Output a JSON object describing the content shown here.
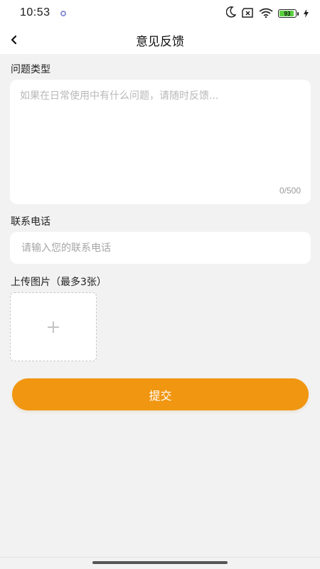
{
  "status_bar": {
    "time": "10:53",
    "battery": "93"
  },
  "navbar": {
    "title": "意见反馈"
  },
  "form": {
    "question_label": "问题类型",
    "question_placeholder": "如果在日常使用中有什么问题，请随时反馈...",
    "question_value": "",
    "char_counter": "0/500",
    "phone_label": "联系电话",
    "phone_placeholder": "请输入您的联系电话",
    "phone_value": "",
    "upload_label": "上传图片（最多3张）",
    "submit_label": "提交"
  },
  "icons": {
    "back": "back-arrow-icon",
    "add": "plus-icon",
    "moon": "moon-icon",
    "sim": "sim-off-icon",
    "wifi": "wifi-icon",
    "battery": "battery-icon",
    "charging": "charging-icon"
  },
  "colors": {
    "accent": "#f09610",
    "background": "#f2f2f2",
    "battery": "#5bd142"
  }
}
